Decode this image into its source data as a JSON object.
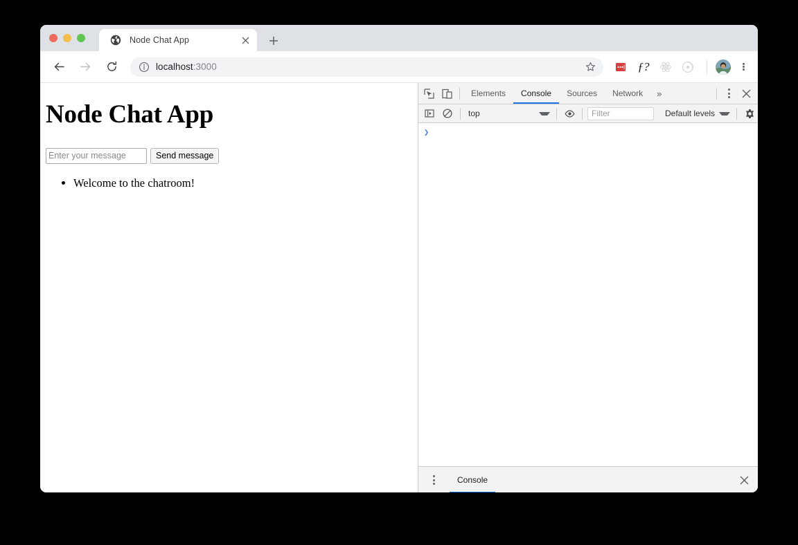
{
  "browser": {
    "window_controls": [
      {
        "name": "close",
        "color": "#ee6a5f"
      },
      {
        "name": "minimize",
        "color": "#f5bf4f"
      },
      {
        "name": "maximize",
        "color": "#61c554"
      }
    ],
    "tab": {
      "title": "Node Chat App",
      "favicon": "globe-icon",
      "close_icon": "close-icon"
    },
    "new_tab_icon": "plus-icon",
    "nav": {
      "back_icon": "arrow-left-icon",
      "forward_icon": "arrow-right-icon",
      "reload_icon": "reload-icon"
    },
    "omnibox": {
      "site_info_icon": "info-circle-icon",
      "url_host": "localhost",
      "url_port": ":3000",
      "bookmark_icon": "star-icon"
    },
    "extensions": [
      {
        "name": "lastpass-extension-icon",
        "color": "#d73f3f"
      },
      {
        "name": "function-extension-icon",
        "label": "ƒ?"
      },
      {
        "name": "react-devtools-extension-icon",
        "color": "#d9d9d9"
      },
      {
        "name": "redux-devtools-extension-icon",
        "color": "#d9d9d9"
      }
    ],
    "avatar": "profile-avatar",
    "menu_icon": "kebab-menu-icon"
  },
  "page": {
    "heading": "Node Chat App",
    "input_placeholder": "Enter your message",
    "input_value": "",
    "send_label": "Send message",
    "messages": [
      "Welcome to the chatroom!"
    ]
  },
  "devtools": {
    "inspect_icon": "inspect-element-icon",
    "device_icon": "device-toolbar-icon",
    "tabs": [
      {
        "label": "Elements",
        "selected": false
      },
      {
        "label": "Console",
        "selected": true
      },
      {
        "label": "Sources",
        "selected": false
      },
      {
        "label": "Network",
        "selected": false
      }
    ],
    "more_tabs_label": "»",
    "kebab_icon": "devtools-menu-icon",
    "close_icon": "devtools-close-icon",
    "console_toolbar": {
      "sidebar_icon": "console-sidebar-icon",
      "clear_icon": "clear-console-icon",
      "context": "top",
      "eye_icon": "live-expression-icon",
      "filter_placeholder": "Filter",
      "filter_value": "",
      "levels": "Default levels",
      "settings_icon": "gear-icon"
    },
    "console": {
      "prompt_caret": "❯",
      "entries": []
    },
    "drawer": {
      "kebab_icon": "drawer-menu-icon",
      "tab_label": "Console",
      "close_icon": "drawer-close-icon"
    }
  },
  "colors": {
    "accent": "#1a73e8",
    "tabstrip_bg": "#dee1e6",
    "devtools_bg": "#f3f3f3",
    "prompt_blue": "#4a7fd4"
  }
}
